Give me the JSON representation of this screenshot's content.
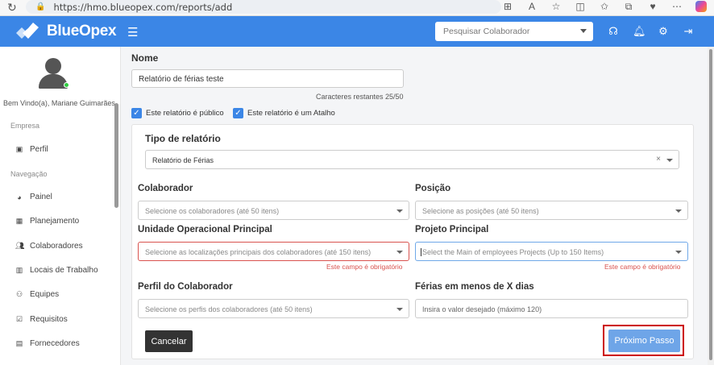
{
  "browser": {
    "url": "https://hmo.blueopex.com/reports/add"
  },
  "header": {
    "brand": "BlueOpex",
    "search_placeholder": "Pesquisar Colaborador"
  },
  "sidebar": {
    "welcome": "Bem Vindo(a), Mariane Guimarães",
    "section_company": "Empresa",
    "section_nav": "Navegação",
    "items": [
      {
        "label": "Perfil",
        "icon": "id-card-icon"
      },
      {
        "label": "Painel",
        "icon": "dashboard-icon"
      },
      {
        "label": "Planejamento",
        "icon": "calendar-icon"
      },
      {
        "label": "Colaboradores",
        "icon": "users-icon"
      },
      {
        "label": "Locais de Trabalho",
        "icon": "building-icon"
      },
      {
        "label": "Equipes",
        "icon": "team-icon"
      },
      {
        "label": "Requisitos",
        "icon": "checkbox-icon"
      },
      {
        "label": "Fornecedores",
        "icon": "briefcase-icon"
      }
    ]
  },
  "form": {
    "name_label": "Nome",
    "name_value": "Relatório de férias teste",
    "chars_remaining": "Caracteres restantes 25/50",
    "public_label": "Este relatório é público",
    "shortcut_label": "Este relatório é um Atalho",
    "report_type_label": "Tipo de relatório",
    "report_type_value": "Relatório de Férias",
    "collaborator_label": "Colaborador",
    "collaborator_placeholder": "Selecione os colaboradores (até 50 itens)",
    "position_label": "Posição",
    "position_placeholder": "Selecione as posições (até 50 itens)",
    "unit_label": "Unidade Operacional Principal",
    "unit_placeholder": "Selecione as localizações principais dos colaboradores (até 150 itens)",
    "unit_error": "Este campo é obrigatório",
    "project_label": "Projeto Principal",
    "project_placeholder": "Select the Main of employees Projects (Up to 150 Items)",
    "project_error": "Este campo é obrigatório",
    "profile_label": "Perfil do Colaborador",
    "profile_placeholder": "Selecione os perfis dos colaboradores (até 50 itens)",
    "vacation_label": "Férias em menos de X dias",
    "vacation_placeholder": "Insira o valor desejado (máximo 120)",
    "cancel_label": "Cancelar",
    "next_label": "Próximo Passo"
  },
  "colors": {
    "brand": "#3b86e6",
    "error": "#d9534f",
    "highlight": "#cc0000"
  }
}
